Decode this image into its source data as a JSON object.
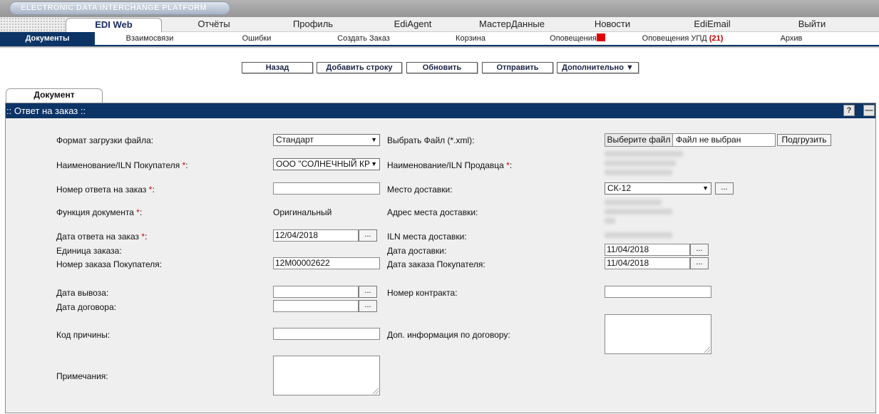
{
  "brand": {
    "title": "ELECTRONIC DATA INTERCHANGE PLATFORM"
  },
  "main_nav": {
    "active": "EDI Web",
    "items": [
      "Отчёты",
      "Профиль",
      "EdiAgent",
      "МастерДанные",
      "Новости",
      "EdiEmail",
      "Выйти"
    ]
  },
  "sub_nav": {
    "active": "Документы",
    "items": [
      "Взаимосвязи",
      "Ошибки",
      "Создать Заказ",
      "Корзина",
      "Оповещения",
      "Оповещения УПД",
      "Архив"
    ],
    "upd_count": "(21)"
  },
  "actions": {
    "back": "Назад",
    "add_row": "Добавить строку",
    "refresh": "Обновить",
    "send": "Отправить",
    "more": "Дополнительно ▼"
  },
  "doc_tab": "Документ",
  "panel": {
    "title": ":: Ответ на заказ ::",
    "help": "?",
    "minimize": "—"
  },
  "form": {
    "upload_format_label": "Формат загрузки файла:",
    "upload_format_value": "Стандарт",
    "choose_file_label": "Выбрать Файл (*.xml):",
    "choose_file_button": "Выберите файл",
    "file_status": "Файл не выбран",
    "upload_button": "Подгрузить",
    "buyer_label": "Наименование/ILN Покупателя ",
    "buyer_value": "ООО \"СОЛНЕЧНЫЙ КР",
    "seller_label": "Наименование/ILN Продавца ",
    "order_resp_no_label": "Номер ответа на заказ ",
    "delivery_place_label": "Место доставки:",
    "delivery_place_value": "СК-12",
    "doc_function_label": "Функция документа ",
    "doc_function_value": "Оригинальный",
    "delivery_address_label": "Адрес места доставки:",
    "resp_date_label": "Дата ответа на заказ ",
    "resp_date_value": "12/04/2018",
    "delivery_iln_label": "ILN места доставки:",
    "order_unit_label": "Единица заказа:",
    "delivery_date_label": "Дата доставки:",
    "delivery_date_value": "11/04/2018",
    "buyer_order_no_label": "Номер заказа Покупателя:",
    "buyer_order_no_value": "12M00002622",
    "buyer_order_date_label": "Дата заказа Покупателя:",
    "buyer_order_date_value": "11/04/2018",
    "pickup_date_label": "Дата вывоза:",
    "contract_no_label": "Номер контракта:",
    "contract_date_label": "Дата договора:",
    "reason_code_label": "Код причины:",
    "contract_info_label": "Доп. информация по договору:",
    "notes_label": "Примечания:",
    "required_mark": "*",
    "colon": ":",
    "dots": "..."
  }
}
